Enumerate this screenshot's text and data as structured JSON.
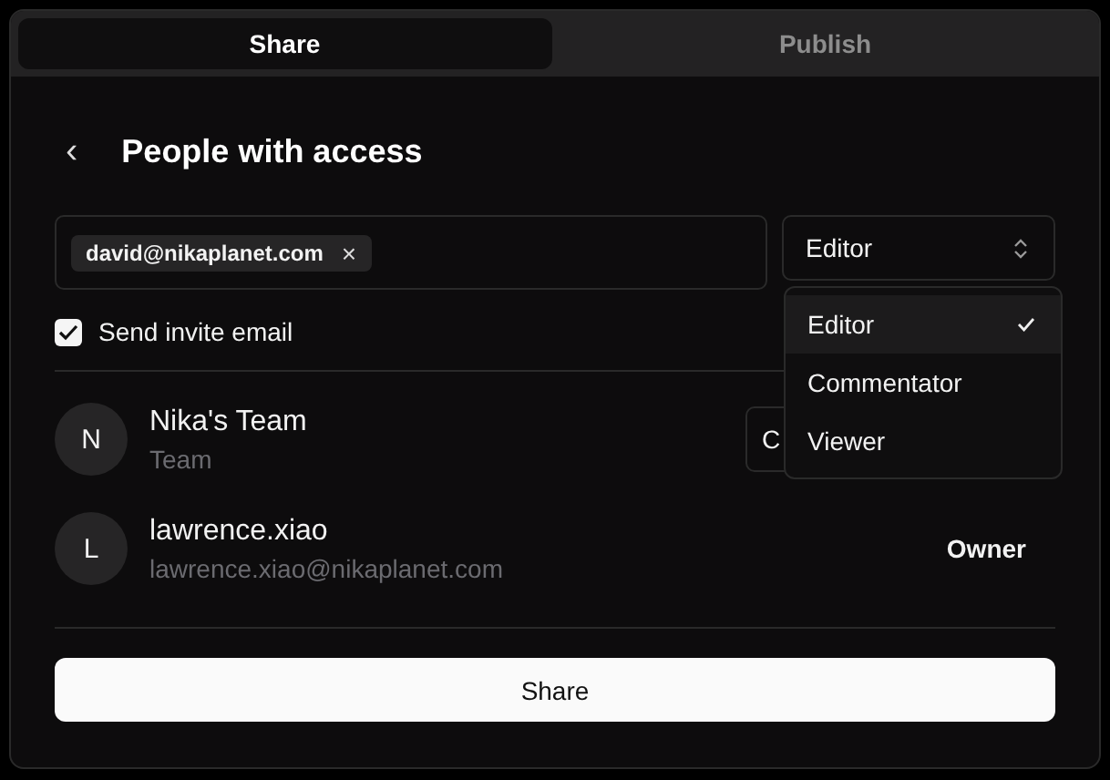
{
  "tabs": [
    {
      "label": "Share",
      "selected": true
    },
    {
      "label": "Publish",
      "selected": false
    }
  ],
  "header": {
    "back": "‹",
    "title": "People with access"
  },
  "invite": {
    "chips": [
      {
        "label": "david@nikaplanet.com",
        "remove": "×"
      }
    ],
    "role": "Editor"
  },
  "role_menu": [
    {
      "label": "Editor",
      "selected": true
    },
    {
      "label": "Commentator",
      "selected": false
    },
    {
      "label": "Viewer",
      "selected": false
    }
  ],
  "send_email": {
    "label": "Send invite email",
    "checked": true
  },
  "people": [
    {
      "initial": "N",
      "name": "Nika's Team",
      "detail": "Team",
      "kind": "select",
      "role": "C"
    },
    {
      "initial": "L",
      "name": "lawrence.xiao",
      "detail": "lawrence.xiao@nikaplanet.com",
      "kind": "label",
      "role": "Owner"
    }
  ],
  "share_button": "Share"
}
